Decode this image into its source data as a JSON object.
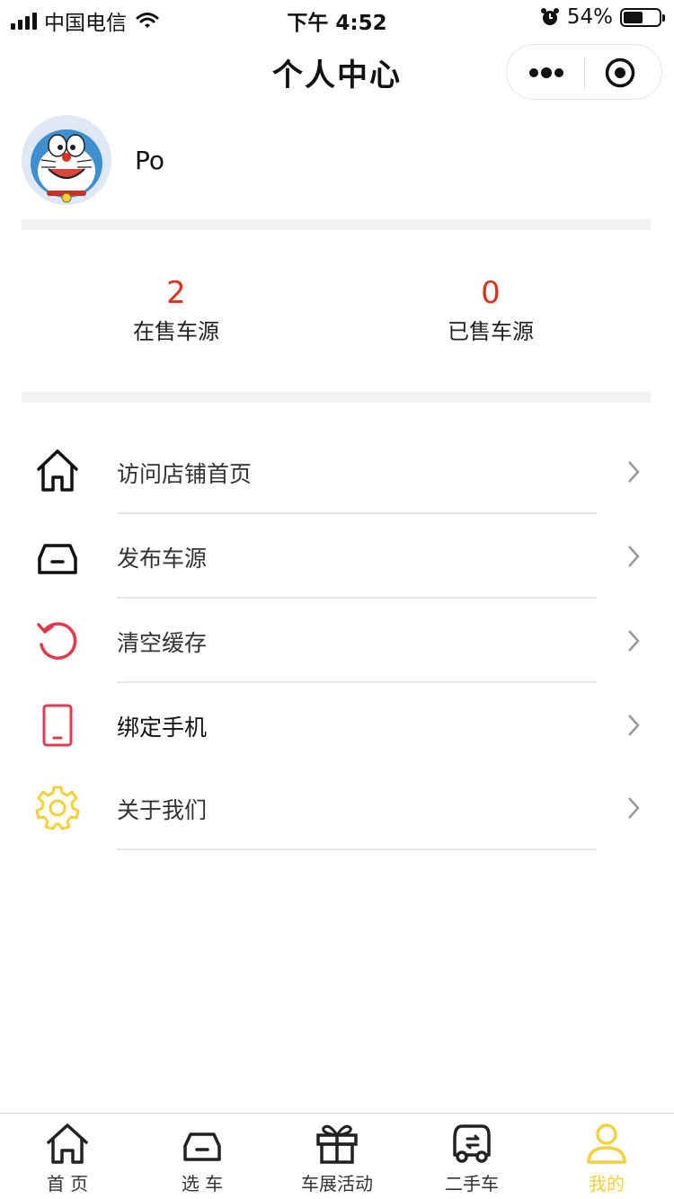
{
  "status_bar": {
    "carrier": "中国电信",
    "time": "下午 4:52",
    "battery": "54%",
    "battery_level": 0.54
  },
  "nav": {
    "title": "个人中心"
  },
  "profile": {
    "name": "Po"
  },
  "stats": [
    {
      "value": "2",
      "label": "在售车源"
    },
    {
      "value": "0",
      "label": "已售车源"
    }
  ],
  "menu": [
    {
      "label": "访问店铺首页",
      "icon": "house-icon",
      "color": "#111111"
    },
    {
      "label": "发布车源",
      "icon": "car-icon",
      "color": "#111111"
    },
    {
      "label": "清空缓存",
      "icon": "refresh-icon",
      "color": "#e23a4c"
    },
    {
      "label": "绑定手机",
      "icon": "phone-icon",
      "color": "#e23a4c"
    },
    {
      "label": "关于我们",
      "icon": "gear-icon",
      "color": "#f4d13c"
    }
  ],
  "tabbar": [
    {
      "label": "首 页",
      "icon": "house-icon"
    },
    {
      "label": "选 车",
      "icon": "car-icon"
    },
    {
      "label": "车展活动",
      "icon": "gift-icon"
    },
    {
      "label": "二手车",
      "icon": "used-car-icon"
    },
    {
      "label": "我的",
      "icon": "user-icon",
      "active": true
    }
  ],
  "colors": {
    "accent": "#f4d13c",
    "stat_number": "#e0301e",
    "danger_icon": "#e23a4c"
  }
}
